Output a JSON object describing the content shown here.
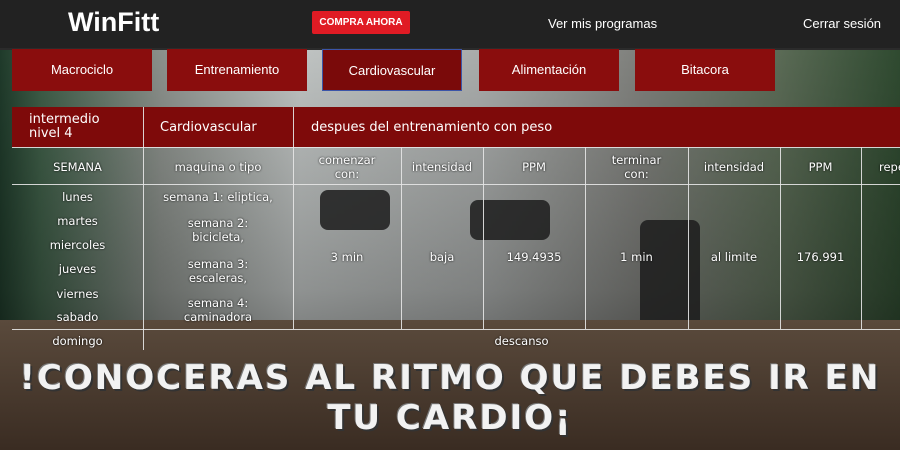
{
  "header": {
    "brand": "WinFitt",
    "buy_label": "COMPRA AHORA",
    "programs_label": "Ver mis programas",
    "logout_label": "Cerrar sesión"
  },
  "tabs": [
    {
      "label": "Macrociclo"
    },
    {
      "label": "Entrenamiento"
    },
    {
      "label": "Cardiovascular"
    },
    {
      "label": "Alimentación"
    },
    {
      "label": "Bitacora"
    }
  ],
  "table": {
    "level": "intermedio\nnivel 4",
    "category": "Cardiovascular",
    "description": "despues del entrenamiento con peso",
    "columns": [
      "SEMANA",
      "maquina o tipo",
      "comenzar\ncon:",
      "intensidad",
      "PPM",
      "terminar\ncon:",
      "intensidad",
      "PPM",
      "repe"
    ],
    "days": [
      "lunes",
      "martes",
      "miercoles",
      "jueves",
      "viernes",
      "sabado",
      "domingo"
    ],
    "machines": [
      "semana 1: eliptica,",
      "semana 2:\nbicicleta,",
      "semana 3:\nescaleras,",
      "semana 4:\ncaminadora"
    ],
    "values": {
      "start": "3 min",
      "intensity_start": "baja",
      "ppm_start": "149.4935",
      "end": "1 min",
      "intensity_end": "al limite",
      "ppm_end": "176.991"
    },
    "rest": "descanso"
  },
  "banner": "!CONOCERAS AL RITMO QUE DEBES IR EN TU CARDIO¡"
}
